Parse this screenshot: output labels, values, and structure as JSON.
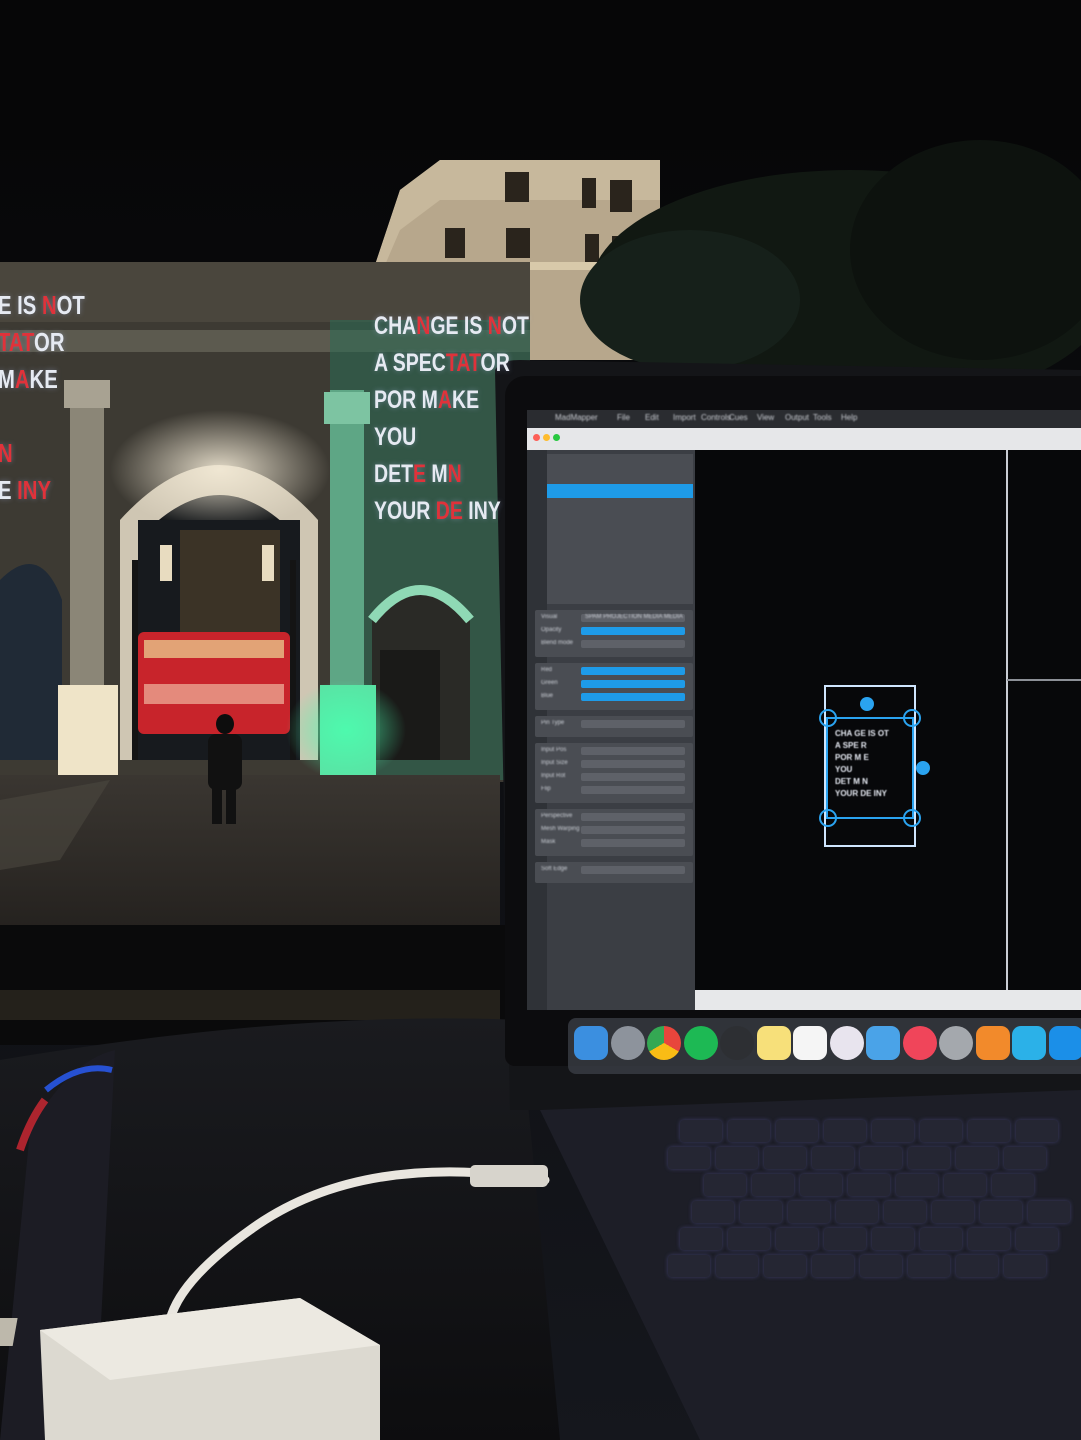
{
  "scene": {
    "projection_left": {
      "lines": [
        {
          "parts": [
            {
              "t": "E IS ",
              "red": false
            },
            {
              "t": "N",
              "red": true
            },
            {
              "t": "OT",
              "red": false
            }
          ]
        },
        {
          "parts": [
            {
              "t": "TAT",
              "red": true
            },
            {
              "t": "OR",
              "red": false
            }
          ]
        },
        {
          "parts": [
            {
              "t": "M",
              "red": false
            },
            {
              "t": "A",
              "red": true
            },
            {
              "t": "KE",
              "red": false
            }
          ]
        },
        {
          "parts": [
            {
              "t": "",
              "red": false
            }
          ]
        },
        {
          "parts": [
            {
              "t": "N",
              "red": true
            }
          ]
        },
        {
          "parts": [
            {
              "t": "E ",
              "red": false
            },
            {
              "t": "INY",
              "red": true
            }
          ]
        }
      ]
    },
    "projection_right": {
      "lines": [
        {
          "parts": [
            {
              "t": "CHA",
              "red": false
            },
            {
              "t": "N",
              "red": true
            },
            {
              "t": "GE IS ",
              "red": false
            },
            {
              "t": "N",
              "red": true
            },
            {
              "t": "OT",
              "red": false
            }
          ]
        },
        {
          "parts": [
            {
              "t": "A SPEC",
              "red": false
            },
            {
              "t": "TAT",
              "red": true
            },
            {
              "t": "OR",
              "red": false
            }
          ]
        },
        {
          "parts": [
            {
              "t": "POR",
              "red": false
            },
            {
              "t": "   M",
              "red": false
            },
            {
              "t": "A",
              "red": true
            },
            {
              "t": "KE",
              "red": false
            }
          ]
        },
        {
          "parts": [
            {
              "t": "YOU",
              "red": false
            }
          ]
        },
        {
          "parts": [
            {
              "t": "DET",
              "red": false
            },
            {
              "t": "E",
              "red": true
            },
            {
              "t": "  M",
              "red": false
            },
            {
              "t": "N",
              "red": true
            }
          ]
        },
        {
          "parts": [
            {
              "t": "YOUR ",
              "red": false
            },
            {
              "t": "DE",
              "red": true
            },
            {
              "t": "   INY",
              "red": false
            }
          ]
        }
      ]
    },
    "laptop": {
      "menu_items": [
        "MadMapper",
        "File",
        "Edit",
        "Import",
        "Controls",
        "Cues",
        "View",
        "Output",
        "Tools",
        "Help"
      ],
      "sidebar_panels": [
        {
          "label": "Visual",
          "value": "SPAM PROJECTION MEDIA MEDIA"
        },
        {
          "label": "Opacity"
        },
        {
          "label": "Blend mode"
        },
        {
          "label": "Red"
        },
        {
          "label": "Green"
        },
        {
          "label": "Blue"
        },
        {
          "label": "Pin Type"
        },
        {
          "label": "Input Pos"
        },
        {
          "label": "Input Size"
        },
        {
          "label": "Input Rot"
        },
        {
          "label": "Flip"
        },
        {
          "label": "Perspective"
        },
        {
          "label": "Mesh Warping"
        },
        {
          "label": "Mask"
        },
        {
          "label": "Soft Edge"
        }
      ],
      "canvas_quad_lines": [
        "CHA  GE IS  OT",
        "A SPE    R",
        "POR  M  E",
        "YOU",
        "DET  M N",
        "YOUR DE  INY"
      ]
    },
    "colors": {
      "projection_red": "#e0323a",
      "projection_white": "#e6eaf2",
      "arch_green": "#3ec98a",
      "bus_red": "#c8242b",
      "ui_accent": "#1e9be8",
      "canvas_outline": "#cfe6ff",
      "handle_blue": "#2aa3f0"
    },
    "dock_icons": [
      "finder-icon",
      "rocket-icon",
      "chrome-icon",
      "spotify-icon",
      "unity-icon",
      "notes-icon",
      "calendar-icon",
      "photos-icon",
      "preview-icon",
      "music-icon",
      "system-preferences-icon",
      "swift-icon",
      "six-icon",
      "app-icon"
    ]
  }
}
